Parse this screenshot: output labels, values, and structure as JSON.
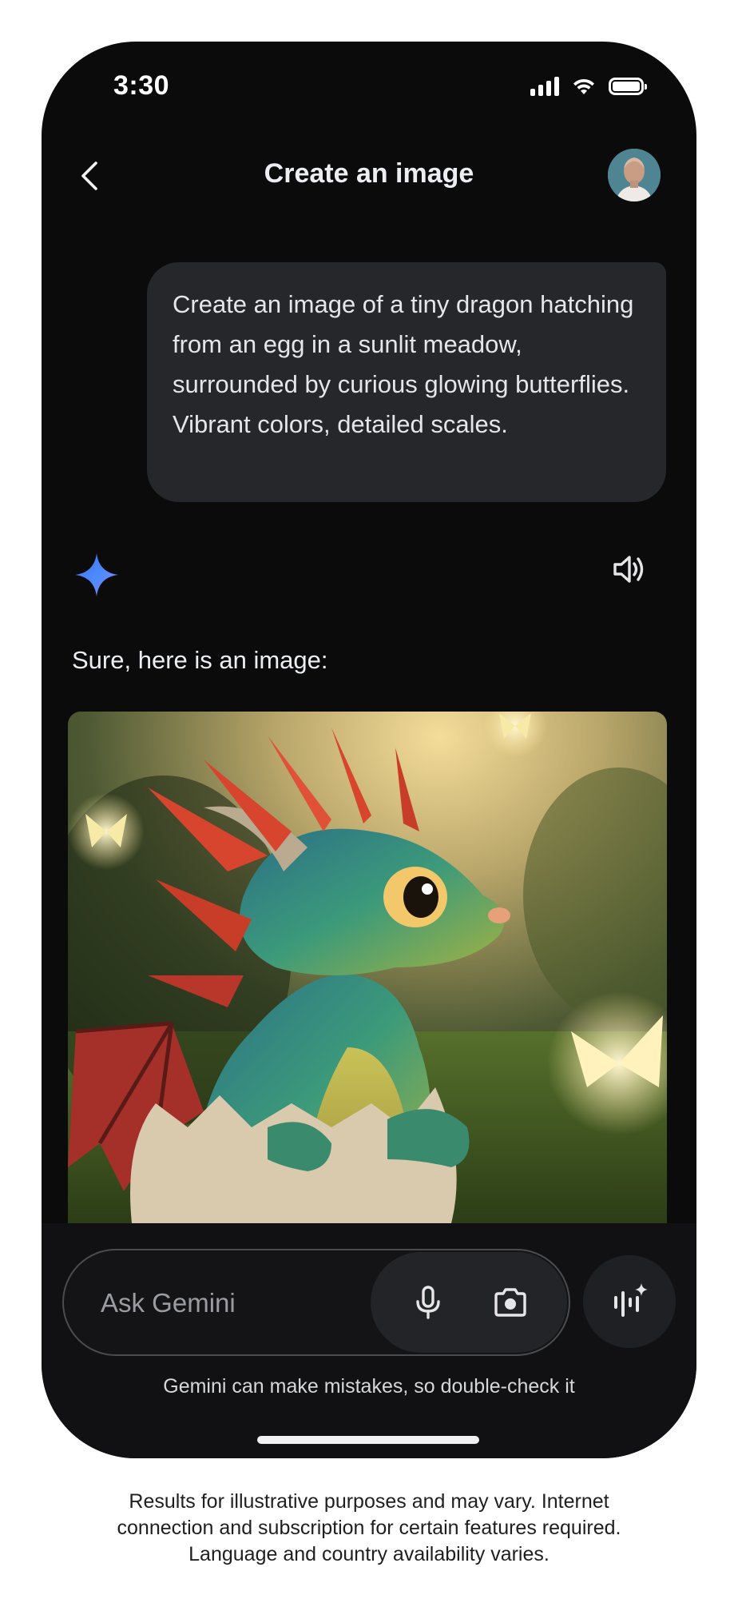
{
  "status_bar": {
    "time": "3:30"
  },
  "header": {
    "title": "Create an image"
  },
  "user_message": {
    "text": "Create an image of a tiny dragon hatching from an egg in a sunlit meadow, surrounded by curious glowing butterflies. Vibrant colors, detailed scales."
  },
  "response": {
    "text": "Sure, here is an image:"
  },
  "input": {
    "placeholder": "Ask Gemini"
  },
  "disclaimer": "Gemini can make mistakes, so double-check it",
  "footer": {
    "line1": "Results for illustrative purposes and may vary. Internet",
    "line2": "connection and subscription for certain features required.",
    "line3": "Language and country availability varies."
  },
  "colors": {
    "phone_bg": "#0b0b0c",
    "bubble_bg": "#26272b",
    "gemini_blue": "#4f8cff",
    "dragon_scales": "#3c9a7a",
    "dragon_crest": "#d8452e"
  },
  "icons": [
    "back-arrow-icon",
    "gemini-star-icon",
    "speaker-icon",
    "microphone-icon",
    "camera-icon",
    "gemini-live-icon"
  ]
}
